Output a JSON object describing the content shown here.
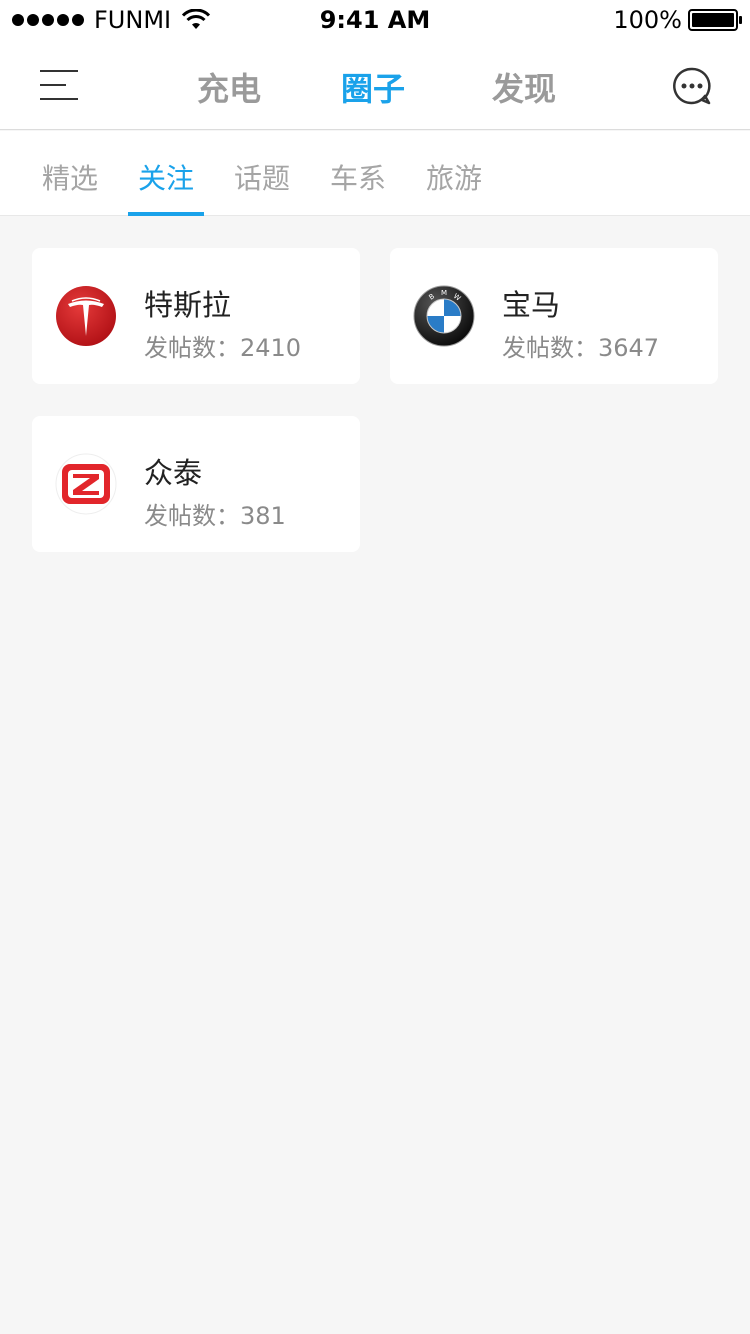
{
  "status_bar": {
    "carrier": "FUNMI",
    "time": "9:41 AM",
    "battery": "100%"
  },
  "nav": {
    "tabs": [
      {
        "label": "充电"
      },
      {
        "label": "圈子"
      },
      {
        "label": "发现"
      }
    ],
    "active_tab": "圈子"
  },
  "sub_tabs": {
    "items": [
      {
        "label": "精选"
      },
      {
        "label": "关注"
      },
      {
        "label": "话题"
      },
      {
        "label": "车系"
      },
      {
        "label": "旅游"
      }
    ],
    "active": "关注"
  },
  "circles": [
    {
      "name": "特斯拉",
      "posts_label": "发帖数：",
      "posts": "2410",
      "icon": "tesla-logo"
    },
    {
      "name": "宝马",
      "posts_label": "发帖数：",
      "posts": "3647",
      "icon": "bmw-logo"
    },
    {
      "name": "众泰",
      "posts_label": "发帖数：",
      "posts": "381",
      "icon": "zotye-logo"
    }
  ],
  "colors": {
    "accent": "#1aa2ea",
    "inactive": "#9a9a9a",
    "background": "#f6f6f6",
    "tesla_red": "#c8161d",
    "zotye_red": "#e2262b"
  }
}
